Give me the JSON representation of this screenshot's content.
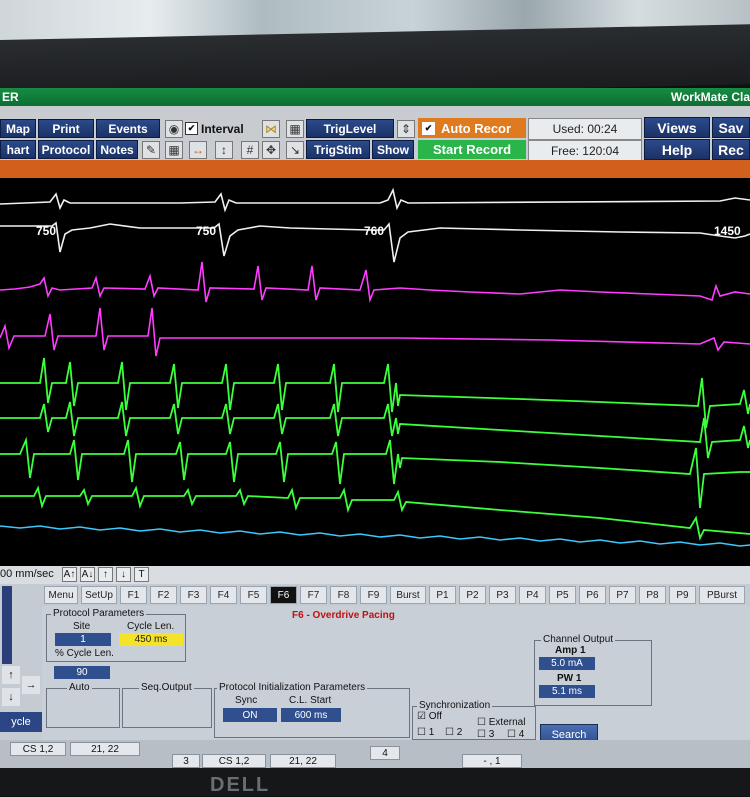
{
  "window": {
    "title_left": "ER",
    "title_right": "WorkMate Cla"
  },
  "toolbar": {
    "map": "Map",
    "print": "Print",
    "events": "Events",
    "interval": "Interval",
    "chart": "hart",
    "protocol": "Protocol",
    "notes": "Notes",
    "triglevel": "TrigLevel",
    "trigstim": "TrigStim",
    "show": "Show",
    "auto_record": "Auto Recor",
    "start_record": "Start Record",
    "used": "Used: 00:24",
    "free": "Free: 120:04",
    "views": "Views",
    "help": "Help",
    "save": "Sav",
    "rec": "Rec"
  },
  "intervals": {
    "a": "750",
    "b": "750",
    "c": "760",
    "d": "1450"
  },
  "speed": {
    "label": "00 mm/sec"
  },
  "tabs": [
    "Menu",
    "SetUp",
    "F1",
    "F2",
    "F3",
    "F4",
    "F5",
    "F6",
    "F7",
    "F8",
    "F9",
    "Burst",
    "P1",
    "P2",
    "P3",
    "P4",
    "P5",
    "P6",
    "P7",
    "P8",
    "P9",
    "PBurst"
  ],
  "active_tab": "F6",
  "protocol": {
    "header": "F6 - Overdrive Pacing",
    "params_title": "Protocol Parameters",
    "site_label": "Site",
    "site_value": "1",
    "cycle_len_label": "Cycle Len.",
    "cycle_len_value": "450 ms",
    "pct_cycle_label": "% Cycle Len.",
    "pct_cycle_value": "90",
    "auto_title": "Auto",
    "seq_title": "Seq.Output",
    "init_title": "Protocol Initialization Parameters",
    "sync_label": "Sync",
    "sync_value": "ON",
    "cl_start_label": "C.L. Start",
    "cl_start_value": "600 ms",
    "syncro_title": "Synchronization",
    "off": "Off",
    "external": "External",
    "n1": "1",
    "n2": "2",
    "n3": "3",
    "n4": "4",
    "search": "Search",
    "channel_title": "Channel Output",
    "amp_label": "Amp 1",
    "amp_value": "5.0 mA",
    "pw_label": "PW 1",
    "pw_value": "5.1 ms"
  },
  "leftcol": {
    "cycle": "ycle"
  },
  "bottom": {
    "cs1": "CS 1,2",
    "c2122": "21, 22",
    "b3": "3",
    "cs2": "CS 1,2",
    "c2122b": "21, 22",
    "b4": "4",
    "last": "- , 1"
  },
  "colors": {
    "surface": "#f0f0f0",
    "ventricular": "#ff3cff",
    "catheter": "#3cff3c",
    "pressure": "#3cc8ff"
  }
}
